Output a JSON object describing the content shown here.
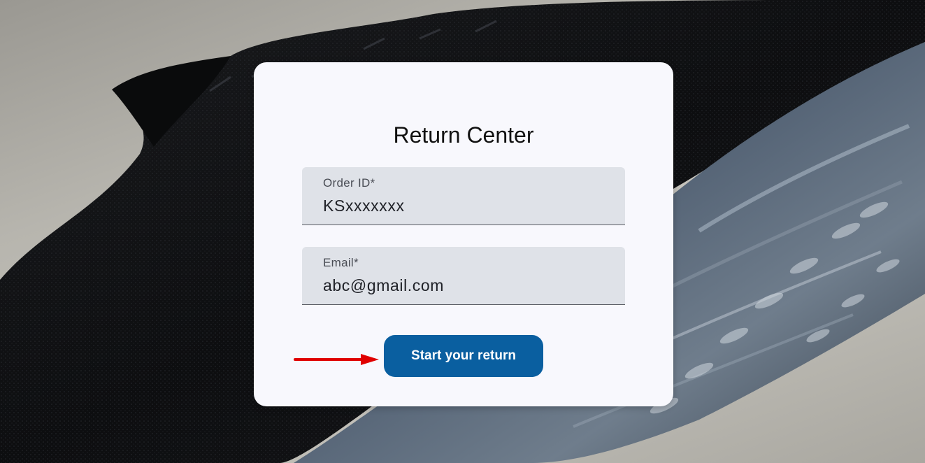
{
  "form": {
    "title": "Return Center",
    "order_id": {
      "label": "Order ID*",
      "value": "KSxxxxxxx"
    },
    "email": {
      "label": "Email*",
      "value": "abc@gmail.com"
    },
    "submit_label": "Start your return"
  },
  "annotation": {
    "arrow_color": "#e00000"
  },
  "colors": {
    "button": "#0a5fa0",
    "card": "#f8f8fd",
    "field": "#dfe2e8"
  }
}
